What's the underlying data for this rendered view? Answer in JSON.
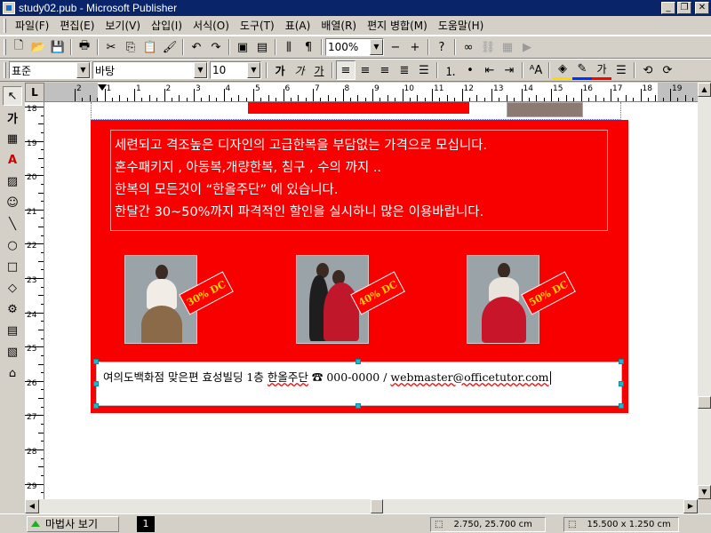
{
  "window": {
    "title": "study02.pub - Microsoft Publisher"
  },
  "menu": [
    "파일(F)",
    "편집(E)",
    "보기(V)",
    "삽입(I)",
    "서식(O)",
    "도구(T)",
    "표(A)",
    "배열(R)",
    "편지 병합(M)",
    "도움말(H)"
  ],
  "toolbar": {
    "zoom": "100%"
  },
  "format": {
    "style": "표준",
    "font": "바탕",
    "size": "10",
    "btn_bold": "가",
    "btn_italic": "가",
    "btn_underline": "가",
    "btn_fontcolor": "가"
  },
  "obj_tools": {
    "text_tool": "가"
  },
  "ruler": {
    "h_labels": [
      "2",
      "1",
      "1",
      "2",
      "3",
      "4",
      "5",
      "6",
      "7",
      "8",
      "9",
      "10",
      "11",
      "12",
      "13",
      "14",
      "15",
      "16",
      "17",
      "18",
      "19",
      "20"
    ],
    "v_labels": [
      "18",
      "19",
      "20",
      "21",
      "22",
      "23",
      "24",
      "25",
      "26",
      "27",
      "28",
      "29"
    ]
  },
  "document": {
    "lines": [
      "세련되고 격조높은 디자인의 고급한복을 부담없는 가격으로 모십니다.",
      "혼수패키지 , 아동복,개량한복, 침구 , 수의 까지 ..",
      "한복의 모든것이 “한올주단” 에 있습니다.",
      "한달간 30~50%까지 파격적인 할인을 실시하니 많은 이용바랍니다."
    ],
    "discounts": [
      "30% DC",
      "40% DC",
      "50% DC"
    ],
    "footer": {
      "address": "여의도백화점 맞은편 효성빌딩 1층 ",
      "shop": "한올주단",
      "phone_icon": "☎",
      "phone": " 000-0000 / ",
      "email": "webmaster@officetutor.com"
    }
  },
  "status": {
    "wizard": "마법사 보기",
    "page": "1",
    "position": "2.750, 25.700 cm",
    "size": "15.500 x  1.250 cm"
  },
  "colors": {
    "banner": "#f90000",
    "discount_text": "#ffd800",
    "titlebar": "#0a246a",
    "handle": "#22b8cc"
  }
}
